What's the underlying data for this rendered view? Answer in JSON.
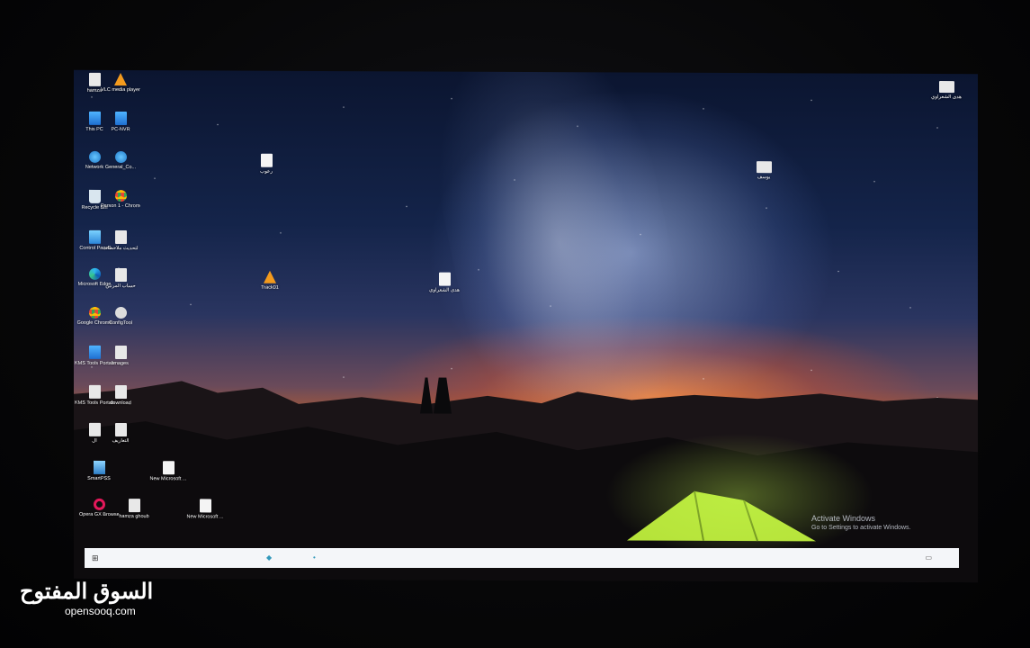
{
  "desktop_icons_left": [
    {
      "label": "hamza",
      "icon": "file-icon"
    },
    {
      "label": "VLC media player",
      "icon": "vlc-icon"
    },
    {
      "label": "This PC",
      "icon": "pc-icon"
    },
    {
      "label": "PC-NVR",
      "icon": "app-icon"
    },
    {
      "label": "Network",
      "icon": "network-icon"
    },
    {
      "label": "General_Co...",
      "icon": "app-icon"
    },
    {
      "label": "Recycle Bin",
      "icon": "recycle-bin-icon"
    },
    {
      "label": "Person 1 - Chrome",
      "icon": "chrome-icon"
    },
    {
      "label": "Control Panel",
      "icon": "control-panel-icon"
    },
    {
      "label": "لتحديث ملاحظات",
      "icon": "file-icon"
    },
    {
      "label": "Microsoft Edge",
      "icon": "edge-icon"
    },
    {
      "label": "حساب المرتين",
      "icon": "file-icon"
    },
    {
      "label": "Google Chrome",
      "icon": "chrome-icon"
    },
    {
      "label": "ConfigTool",
      "icon": "config-icon"
    },
    {
      "label": "KMS Tools Portable",
      "icon": "app-icon"
    },
    {
      "label": "images",
      "icon": "file-icon"
    },
    {
      "label": "KMS Tools Portable.M...",
      "icon": "file-icon"
    },
    {
      "label": "download",
      "icon": "file-icon"
    },
    {
      "label": "ال",
      "icon": "file-icon"
    },
    {
      "label": "التعاريف",
      "icon": "file-icon"
    },
    {
      "label": "SmartPSS",
      "icon": "smartpss-icon"
    },
    {
      "label": "New Microsoft ...",
      "icon": "document-icon"
    },
    {
      "label": "Opera GX Browser",
      "icon": "opera-icon"
    },
    {
      "label": "hamza ghoub",
      "icon": "file-icon"
    },
    {
      "label": "New Microsoft ...",
      "icon": "document-icon"
    }
  ],
  "desktop_icons_free": [
    {
      "label": "رعوب",
      "icon": "document-icon"
    },
    {
      "label": "Track01",
      "icon": "vlc-icon"
    },
    {
      "label": "هدى الشعراوي",
      "icon": "app-icon"
    },
    {
      "label": "يوسف",
      "icon": "file-icon"
    },
    {
      "label": "هدى الشعراوي",
      "icon": "file-icon"
    }
  ],
  "activation": {
    "title": "Activate Windows",
    "subtitle": "Go to Settings to activate Windows."
  },
  "taskbar": {
    "start_icon": "windows-start-icon",
    "start_glyph": "⊞",
    "pinned_glyph_1": "◆",
    "pinned_glyph_2": "•",
    "tray_glyph": "▭"
  },
  "branding": {
    "arabic": "السوق المفتوح",
    "latin": "opensooq.com"
  }
}
